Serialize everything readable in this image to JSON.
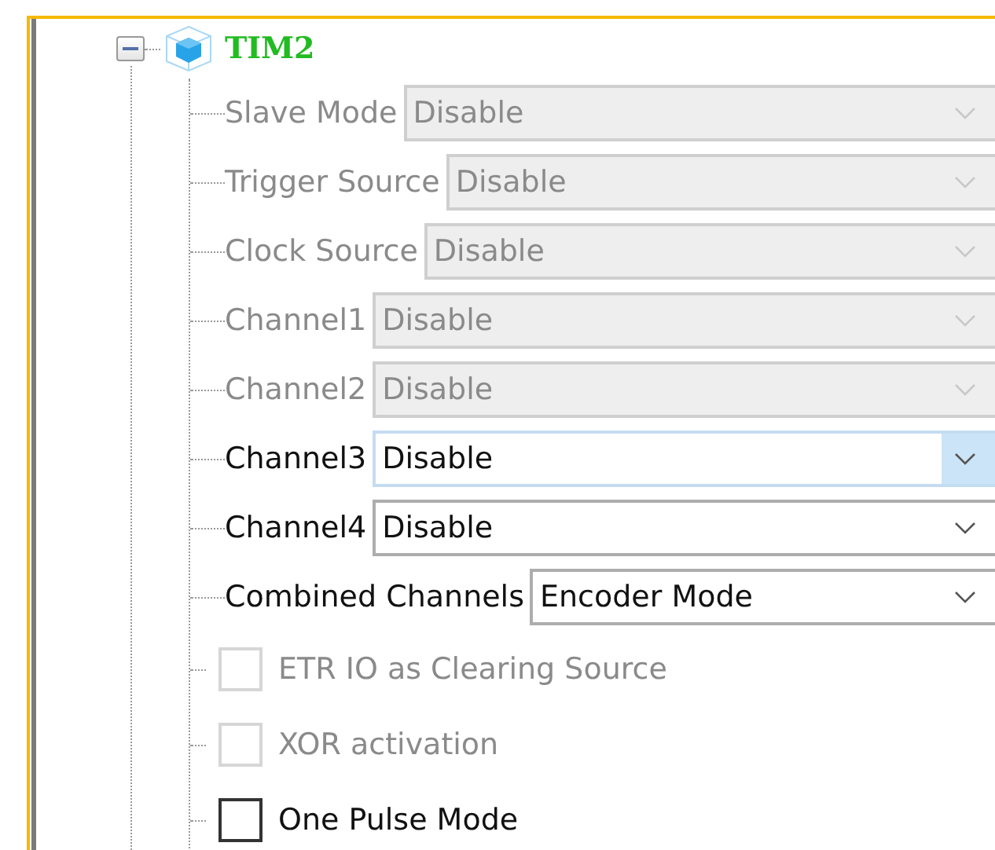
{
  "tree": {
    "node": {
      "label": "TIM2",
      "expanded": true,
      "children": [
        {
          "kind": "dropdown",
          "label": "Slave Mode",
          "value": "Disable",
          "disabled": true,
          "focused": false
        },
        {
          "kind": "dropdown",
          "label": "Trigger Source",
          "value": "Disable",
          "disabled": true,
          "focused": false
        },
        {
          "kind": "dropdown",
          "label": "Clock Source",
          "value": "Disable",
          "disabled": true,
          "focused": false
        },
        {
          "kind": "dropdown",
          "label": "Channel1",
          "value": "Disable",
          "disabled": true,
          "focused": false
        },
        {
          "kind": "dropdown",
          "label": "Channel2",
          "value": "Disable",
          "disabled": true,
          "focused": false
        },
        {
          "kind": "dropdown",
          "label": "Channel3",
          "value": "Disable",
          "disabled": false,
          "focused": true
        },
        {
          "kind": "dropdown",
          "label": "Channel4",
          "value": "Disable",
          "disabled": false,
          "focused": false
        },
        {
          "kind": "dropdown",
          "label": "Combined Channels",
          "value": "Encoder Mode",
          "disabled": false,
          "focused": false
        },
        {
          "kind": "checkbox",
          "label": "ETR IO as Clearing Source",
          "disabled": true,
          "checked": false
        },
        {
          "kind": "checkbox",
          "label": "XOR activation",
          "disabled": true,
          "checked": false
        },
        {
          "kind": "checkbox",
          "label": "One Pulse Mode",
          "disabled": false,
          "checked": false
        }
      ]
    }
  }
}
